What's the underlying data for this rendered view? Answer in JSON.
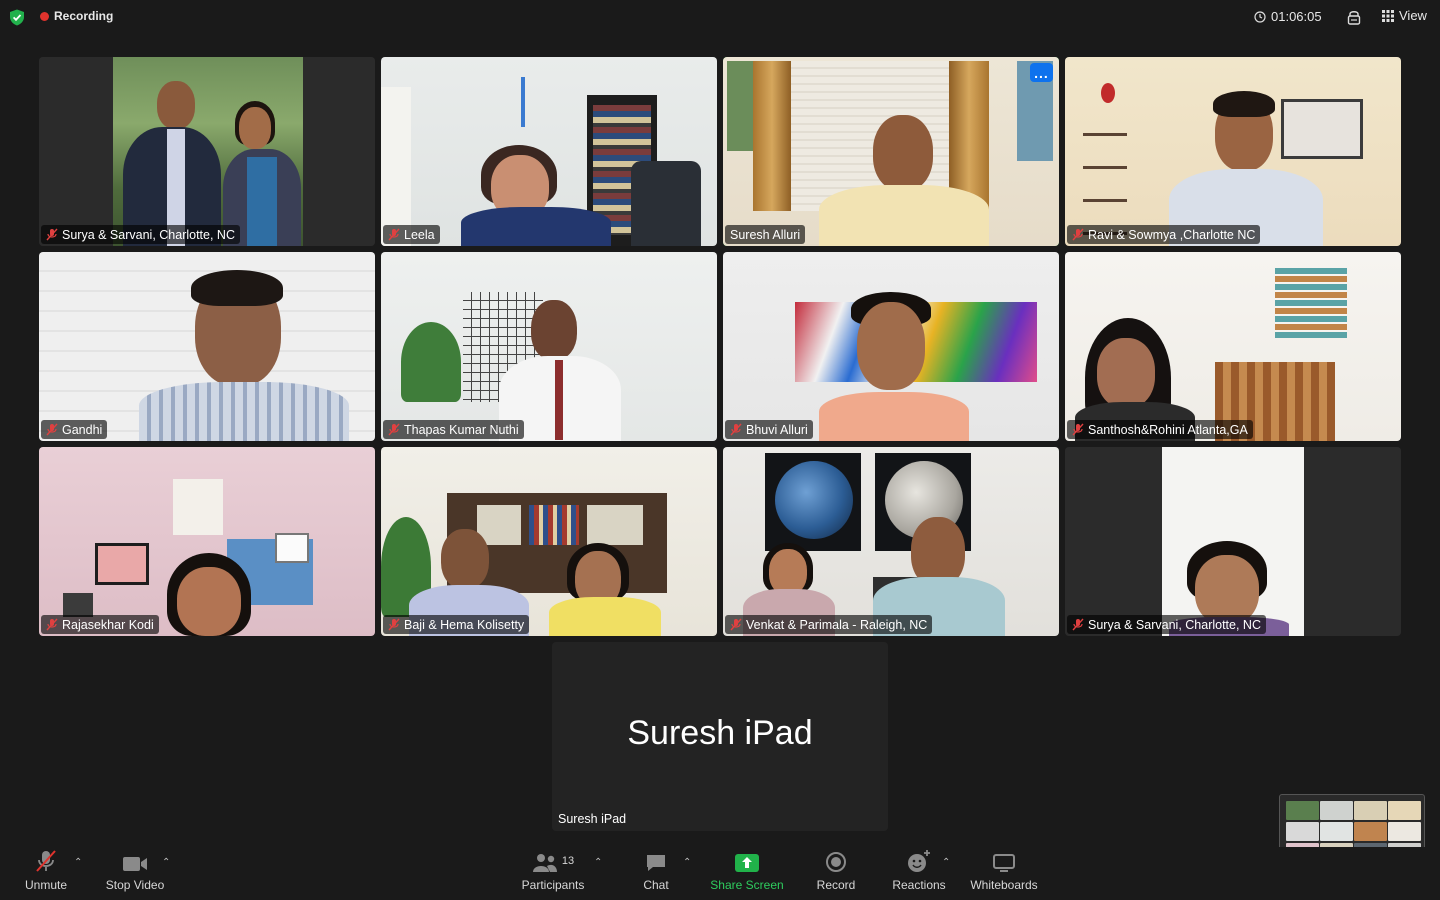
{
  "topbar": {
    "recording_label": "Recording",
    "timer": "01:06:05",
    "view_label": "View"
  },
  "colors": {
    "active_speaker": "#22c84a",
    "share_green": "#21b24a",
    "recording_red": "#e0332d",
    "more_blue": "#0e72ed"
  },
  "participants": [
    {
      "name": "Surya & Sarvani, Charlotte, NC",
      "muted": true
    },
    {
      "name": "Leela",
      "muted": true
    },
    {
      "name": "Suresh Alluri",
      "muted": false,
      "active": true
    },
    {
      "name": "Ravi & Sowmya ,Charlotte NC",
      "muted": true
    },
    {
      "name": "Gandhi",
      "muted": true
    },
    {
      "name": "Thapas Kumar Nuthi",
      "muted": true
    },
    {
      "name": "Bhuvi Alluri",
      "muted": true
    },
    {
      "name": "Santhosh&Rohini Atlanta,GA",
      "muted": true
    },
    {
      "name": "Rajasekhar Kodi",
      "muted": true
    },
    {
      "name": "Baji & Hema Kolisetty",
      "muted": true
    },
    {
      "name": "Venkat & Parimala - Raleigh, NC",
      "muted": true
    },
    {
      "name": "Surya & Sarvani, Charlotte, NC",
      "muted": true
    }
  ],
  "ipad_tile": {
    "display_name": "Suresh iPad",
    "name_tag": "Suresh iPad"
  },
  "more_button": "...",
  "toolbar": {
    "unmute": "Unmute",
    "stop_video": "Stop Video",
    "participants": "Participants",
    "participants_count": "13",
    "chat": "Chat",
    "share_screen": "Share Screen",
    "record": "Record",
    "reactions": "Reactions",
    "whiteboards": "Whiteboards"
  },
  "icons": [
    "shield-check-icon",
    "recording-dot-icon",
    "clock-icon",
    "lock-icon",
    "grid-view-icon",
    "muted-mic-icon",
    "video-camera-icon",
    "participants-icon",
    "chat-bubble-icon",
    "share-screen-arrow-icon",
    "record-icon",
    "reaction-smile-icon",
    "whiteboard-icon",
    "caret-up-icon"
  ]
}
